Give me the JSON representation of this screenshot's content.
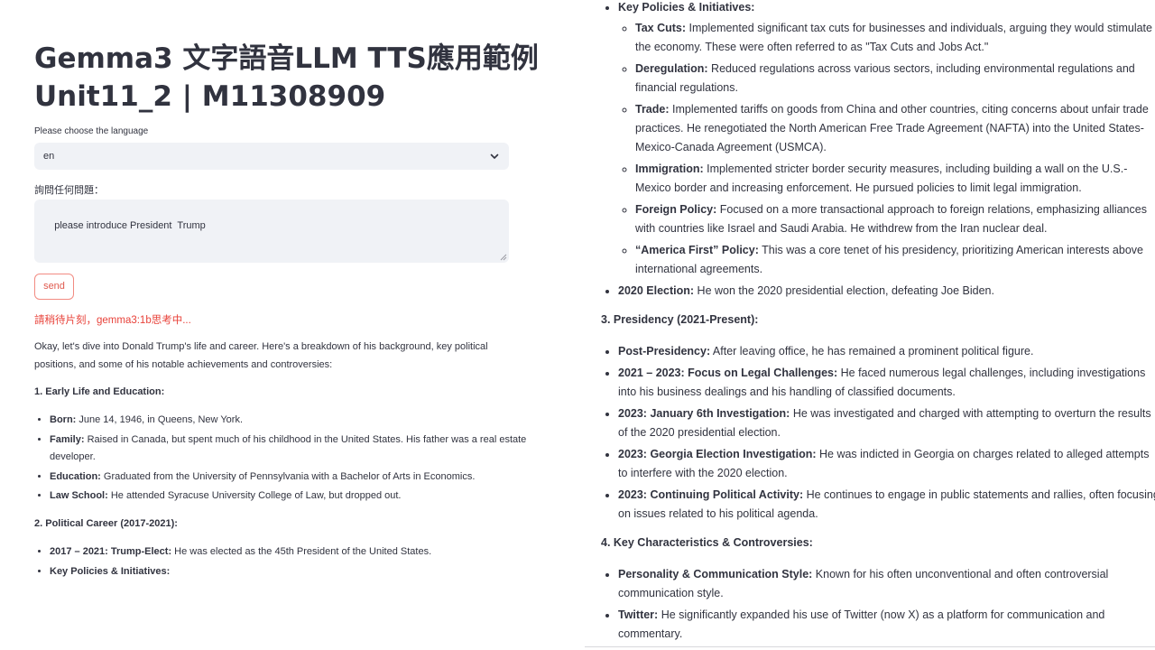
{
  "app": {
    "title_line1": "Gemma3 文字語音LLM TTS應用範例",
    "title_line2": "Unit11_2 | M11308909"
  },
  "language": {
    "label": "Please choose the language",
    "selected": "en"
  },
  "question": {
    "label": "詢問任何問題：",
    "value": "please introduce President  Trump"
  },
  "send_label": "send",
  "status": "請稍待片刻，gemma3:1b思考中...",
  "response_left": {
    "intro": "Okay, let's dive into Donald Trump's life and career. Here's a breakdown of his background, key political positions, and some of his notable achievements and controversies:",
    "sec1_heading": "1. Early Life and Education:",
    "sec1_items": [
      {
        "label": "Born:",
        "text": " June 14, 1946, in Queens, New York."
      },
      {
        "label": "Family:",
        "text": " Raised in Canada, but spent much of his childhood in the United States. His father was a real estate developer."
      },
      {
        "label": "Education:",
        "text": " Graduated from the University of Pennsylvania with a Bachelor of Arts in Economics."
      },
      {
        "label": "Law School:",
        "text": " He attended Syracuse University College of Law, but dropped out."
      }
    ],
    "sec2_heading": "2. Political Career (2017-2021):",
    "sec2_items": [
      {
        "label": "2017 – 2021: Trump-Elect:",
        "text": " He was elected as the 45th President of the United States."
      },
      {
        "label": "Key Policies & Initiatives:",
        "text": ""
      }
    ]
  },
  "response_right": {
    "policies_label": "Key Policies & Initiatives:",
    "policies": [
      {
        "label": "Tax Cuts:",
        "text": " Implemented significant tax cuts for businesses and individuals, arguing they would stimulate the economy. These were often referred to as \"Tax Cuts and Jobs Act.\""
      },
      {
        "label": "Deregulation:",
        "text": " Reduced regulations across various sectors, including environmental regulations and financial regulations."
      },
      {
        "label": "Trade:",
        "text": " Implemented tariffs on goods from China and other countries, citing concerns about unfair trade practices. He renegotiated the North American Free Trade Agreement (NAFTA) into the United States-Mexico-Canada Agreement (USMCA)."
      },
      {
        "label": "Immigration:",
        "text": " Implemented stricter border security measures, including building a wall on the U.S.-Mexico border and increasing enforcement. He pursued policies to limit legal immigration."
      },
      {
        "label": "Foreign Policy:",
        "text": " Focused on a more transactional approach to foreign relations, emphasizing alliances with countries like Israel and Saudi Arabia. He withdrew from the Iran nuclear deal."
      },
      {
        "label": "“America First” Policy:",
        "text": " This was a core tenet of his presidency, prioritizing American interests above international agreements."
      }
    ],
    "election_label": "2020 Election:",
    "election_text": " He won the 2020 presidential election, defeating Joe Biden.",
    "sec3_heading": "3. Presidency (2021-Present):",
    "sec3_items": [
      {
        "label": "Post-Presidency:",
        "text": " After leaving office, he has remained a prominent political figure."
      },
      {
        "label": "2021 – 2023: Focus on Legal Challenges:",
        "text": " He faced numerous legal challenges, including investigations into his business dealings and his handling of classified documents."
      },
      {
        "label": "2023: January 6th Investigation:",
        "text": " He was investigated and charged with attempting to overturn the results of the 2020 presidential election."
      },
      {
        "label": "2023: Georgia Election Investigation:",
        "text": " He was indicted in Georgia on charges related to alleged attempts to interfere with the 2020 election."
      },
      {
        "label": "2023: Continuing Political Activity:",
        "text": " He continues to engage in public statements and rallies, often focusing on issues related to his political agenda."
      }
    ],
    "sec4_heading": "4. Key Characteristics & Controversies:",
    "sec4_items": [
      {
        "label": "Personality & Communication Style:",
        "text": " Known for his often unconventional and often controversial communication style."
      },
      {
        "label": "Twitter:",
        "text": " He significantly expanded his use of Twitter (now X) as a platform for communication and commentary."
      }
    ]
  }
}
